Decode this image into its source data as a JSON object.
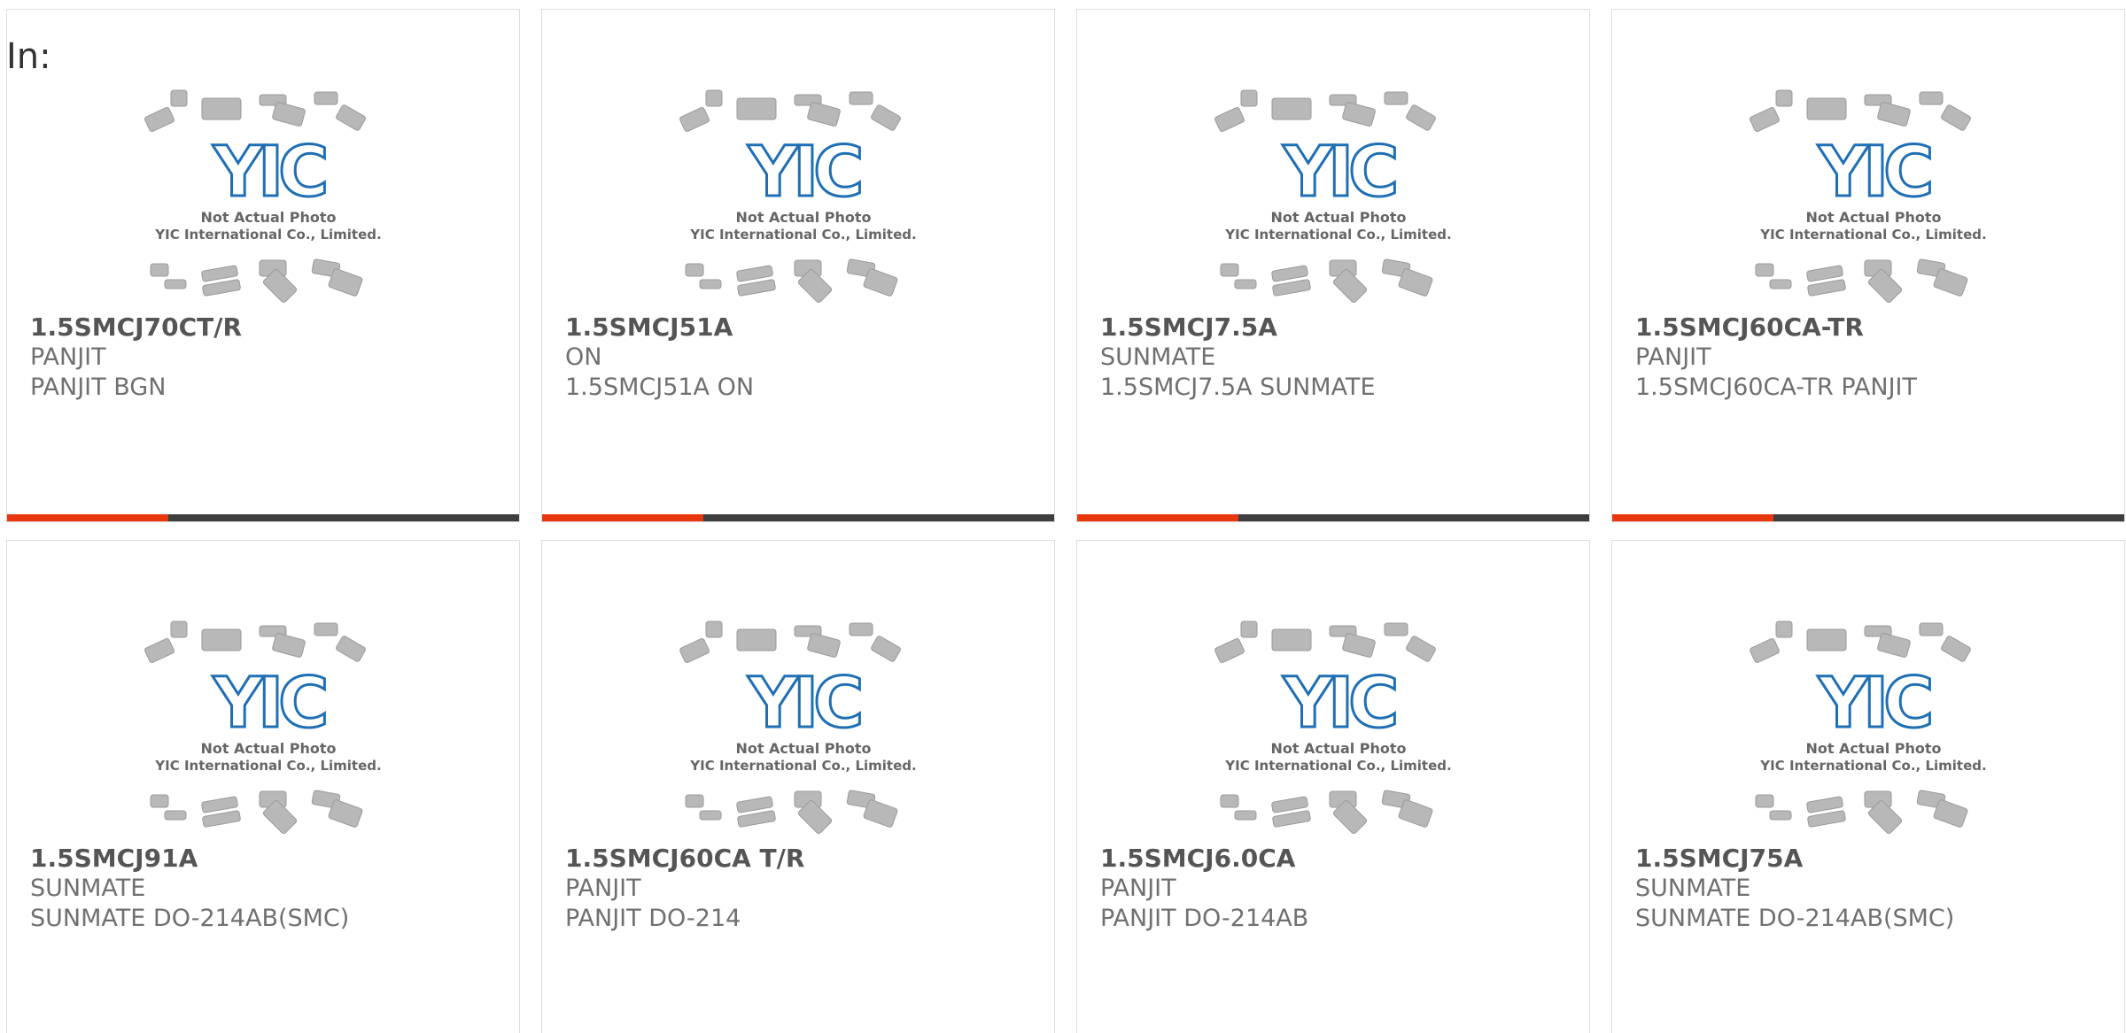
{
  "in_label": "In:",
  "photo": {
    "line1": "Not Actual Photo",
    "line2": "YIC International Co., Limited.",
    "logo_text": "YIC"
  },
  "colors": {
    "accent": "#e8360e",
    "bar": "#3e3e3e",
    "logo_blue": "#1f6fb5"
  },
  "products": [
    {
      "part_number": "1.5SMCJ70CT/R",
      "manufacturer": "PANJIT",
      "description": "PANJIT BGN"
    },
    {
      "part_number": "1.5SMCJ51A",
      "manufacturer": "ON",
      "description": "1.5SMCJ51A ON"
    },
    {
      "part_number": "1.5SMCJ7.5A",
      "manufacturer": "SUNMATE",
      "description": "1.5SMCJ7.5A SUNMATE"
    },
    {
      "part_number": "1.5SMCJ60CA-TR",
      "manufacturer": "PANJIT",
      "description": "1.5SMCJ60CA-TR PANJIT"
    },
    {
      "part_number": "1.5SMCJ91A",
      "manufacturer": "SUNMATE",
      "description": "SUNMATE DO-214AB(SMC)"
    },
    {
      "part_number": "1.5SMCJ60CA T/R",
      "manufacturer": "PANJIT",
      "description": "PANJIT DO-214"
    },
    {
      "part_number": "1.5SMCJ6.0CA",
      "manufacturer": "PANJIT",
      "description": "PANJIT DO-214AB"
    },
    {
      "part_number": "1.5SMCJ75A",
      "manufacturer": "SUNMATE",
      "description": "SUNMATE DO-214AB(SMC)"
    }
  ]
}
